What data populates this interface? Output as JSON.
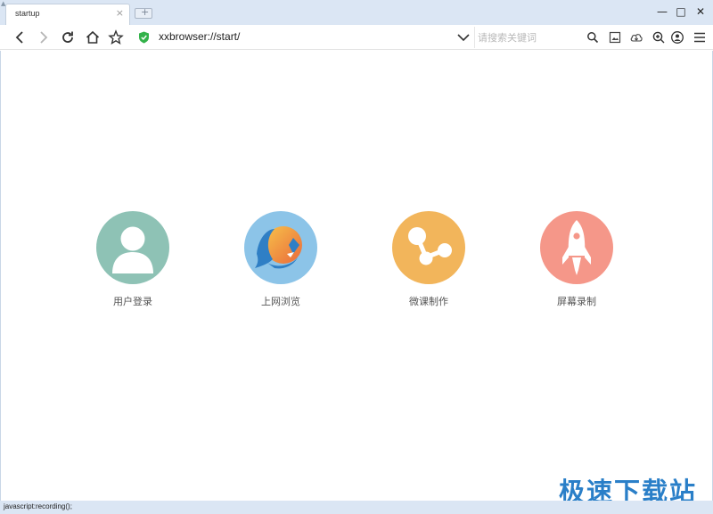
{
  "tab": {
    "title": "startup",
    "close": "×",
    "new_tab": "+"
  },
  "window_controls": {
    "minimize": "—",
    "maximize": "□",
    "close": "✕"
  },
  "toolbar": {
    "address": "xxbrowser://start/",
    "search_placeholder": "请搜索关键词",
    "icons": [
      "back-icon",
      "forward-icon",
      "reload-icon",
      "home-icon",
      "star-icon",
      "shield-icon",
      "chevron-down-icon",
      "search-icon",
      "screenshot-icon",
      "download-icon",
      "zoom-icon",
      "user-icon",
      "menu-icon"
    ]
  },
  "features": [
    {
      "label": "用户登录",
      "icon": "user-icon",
      "color": "#8ec2b5"
    },
    {
      "label": "上网浏览",
      "icon": "browser-icon",
      "color": "#8cc4e8"
    },
    {
      "label": "微课制作",
      "icon": "share-icon",
      "color": "#f2b55b"
    },
    {
      "label": "屏幕录制",
      "icon": "rocket-icon",
      "color": "#f59789"
    }
  ],
  "watermark": "极速下载站",
  "status": "javascript:recording();"
}
